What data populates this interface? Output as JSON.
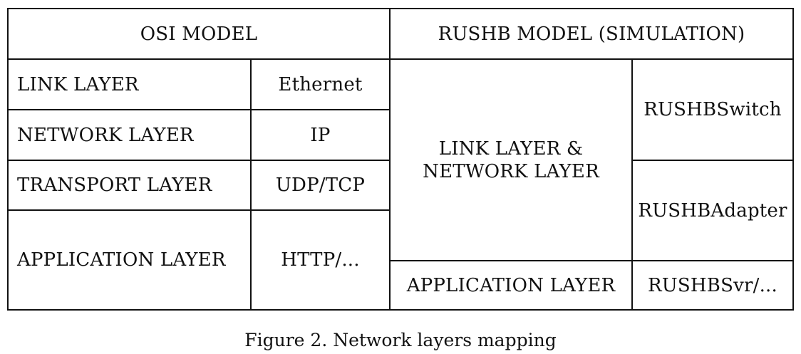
{
  "headers": {
    "osi": "OSI MODEL",
    "rushb": "RUSHB MODEL (SIMULATION)"
  },
  "osi_rows": [
    {
      "layer": "LINK LAYER",
      "protocol": "Ethernet"
    },
    {
      "layer": "NETWORK LAYER",
      "protocol": "IP"
    },
    {
      "layer": "TRANSPORT LAYER",
      "protocol": "UDP/TCP"
    },
    {
      "layer": "APPLICATION LAYER",
      "protocol": "HTTP/..."
    }
  ],
  "rushb": {
    "link_network_line1": "LINK LAYER &",
    "link_network_line2": "NETWORK LAYER",
    "application": "APPLICATION LAYER",
    "switch": "RUSHBSwitch",
    "adapter": "RUSHBAdapter",
    "server": "RUSHBSvr/..."
  },
  "caption": "Figure 2. Network layers mapping"
}
